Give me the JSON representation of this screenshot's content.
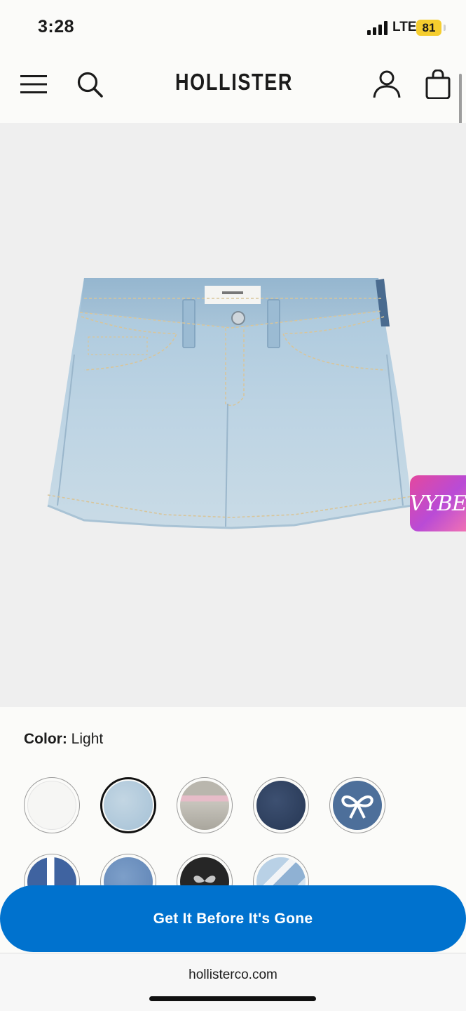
{
  "status_bar": {
    "time": "3:28",
    "network": "LTE",
    "battery": "81",
    "battery_color": "#f5cd2e"
  },
  "nav": {
    "brand": "HOLLISTER",
    "menu_icon": "hamburger-icon",
    "search_icon": "search-icon",
    "account_icon": "person-icon",
    "bag_icon": "shopping-bag-icon"
  },
  "product": {
    "image_alt": "light wash denim mini skirt",
    "badge": "VYBE"
  },
  "color": {
    "label": "Color:",
    "value": "Light",
    "swatches": [
      {
        "name": "white",
        "selected": false
      },
      {
        "name": "light",
        "selected": true
      },
      {
        "name": "pink-floral",
        "selected": false
      },
      {
        "name": "dark",
        "selected": false
      },
      {
        "name": "bow-print",
        "selected": false
      },
      {
        "name": "lace-trim",
        "selected": false
      },
      {
        "name": "medium",
        "selected": false
      },
      {
        "name": "black-bow",
        "selected": false
      },
      {
        "name": "patchwork",
        "selected": false
      }
    ]
  },
  "cta": {
    "label": "Get It Before It's Gone",
    "color": "#0072ce"
  },
  "browser": {
    "url": "hollisterco.com"
  }
}
